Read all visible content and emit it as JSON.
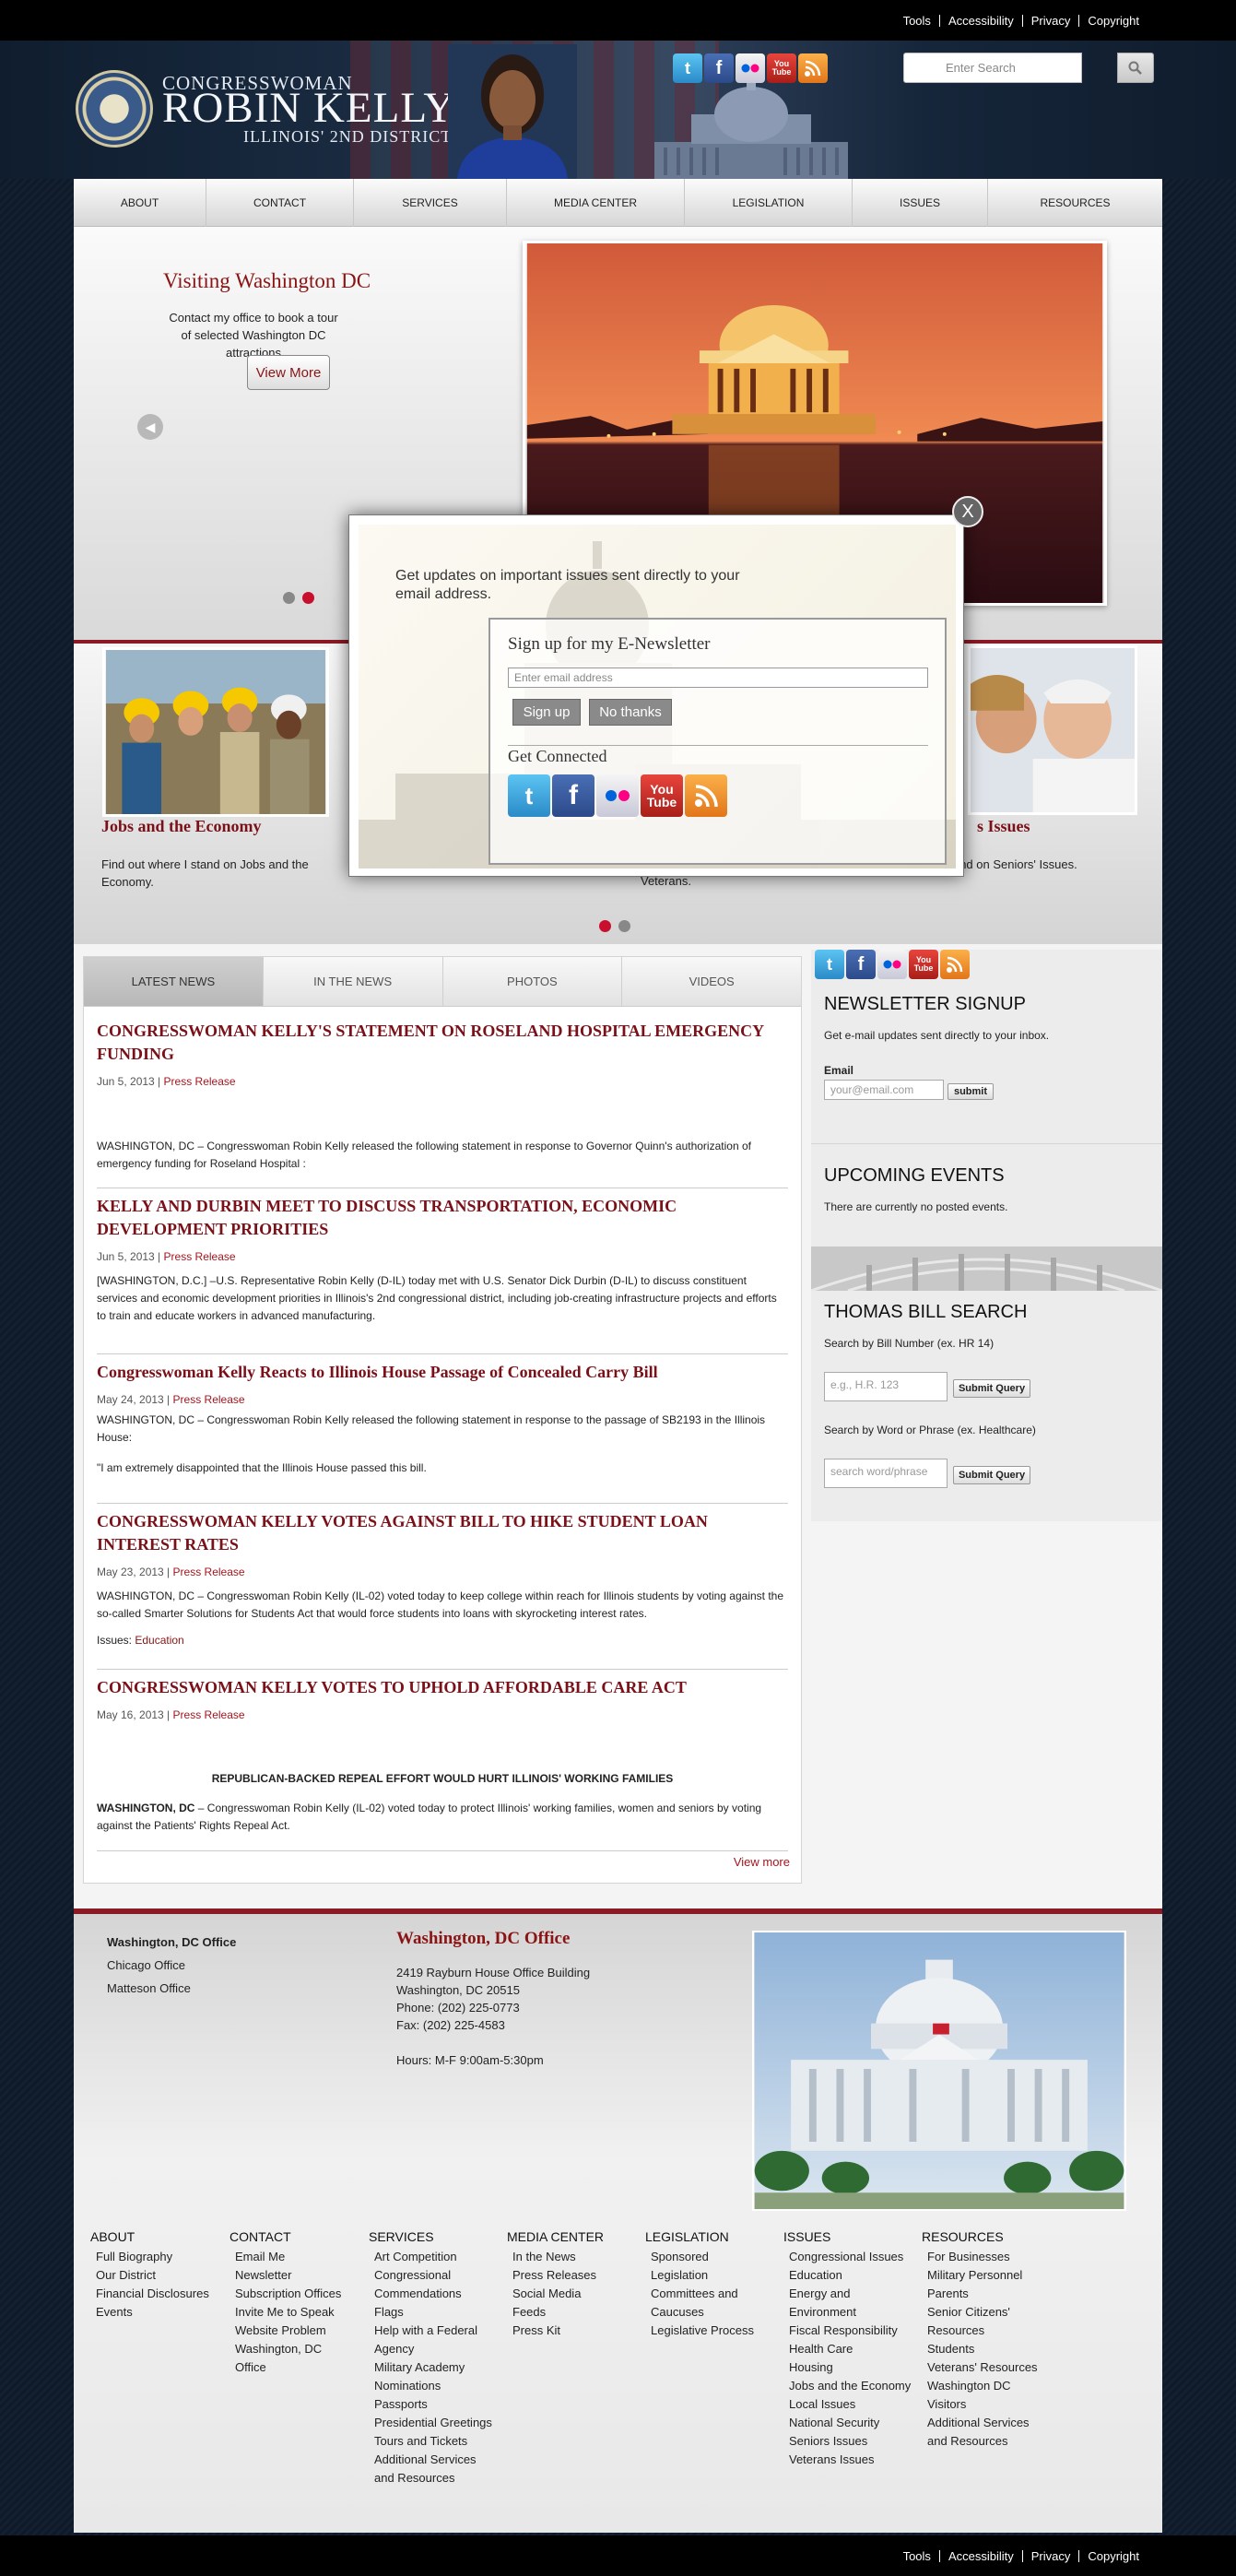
{
  "utility": {
    "tools": "Tools",
    "accessibility": "Accessibility",
    "privacy": "Privacy",
    "copyright": "Copyright"
  },
  "header": {
    "line1": "CONGRESSWOMAN",
    "line2": "ROBIN KELLY",
    "line3": "ILLINOIS' 2ND DISTRICT",
    "search_placeholder": "Enter Search",
    "social": {
      "twitter": "t",
      "facebook": "f",
      "youtube1": "You",
      "youtube2": "Tube"
    }
  },
  "nav": [
    "ABOUT",
    "CONTACT",
    "SERVICES",
    "MEDIA CENTER",
    "LEGISLATION",
    "ISSUES",
    "RESOURCES"
  ],
  "slider": {
    "title": "Visiting Washington DC",
    "text": "Contact my office to book a tour of selected Washington DC attractions",
    "button": "View More"
  },
  "features": [
    {
      "title": "Jobs and the Economy",
      "text": "Find out where I stand on Jobs and the Economy."
    },
    {
      "title": "",
      "text": "Veterans."
    },
    {
      "title": "s Issues",
      "text": "here I stand on Seniors' Issues."
    }
  ],
  "modal": {
    "intro": "Get updates on important issues sent directly to your email address.",
    "title": "Sign up for my E-Newsletter",
    "email_placeholder": "Enter email address",
    "signup": "Sign up",
    "nothanks": "No thanks",
    "connected": "Get Connected",
    "close": "X"
  },
  "tabs": [
    "LATEST NEWS",
    "IN THE NEWS",
    "PHOTOS",
    "VIDEOS"
  ],
  "news": [
    {
      "title": "CONGRESSWOMAN KELLY'S STATEMENT ON ROSELAND HOSPITAL EMERGENCY FUNDING",
      "date": "Jun 5, 2013",
      "type": "Press Release",
      "body": "WASHINGTON, DC –  Congresswoman Robin Kelly released the following statement in response to Governor Quinn's authorization of emergency funding for Roseland Hospital :"
    },
    {
      "title": "KELLY AND DURBIN MEET TO DISCUSS TRANSPORTATION, ECONOMIC DEVELOPMENT PRIORITIES",
      "date": "Jun 5, 2013",
      "type": "Press Release",
      "body": "[WASHINGTON, D.C.] –U.S. Representative Robin Kelly (D-IL) today met with U.S. Senator Dick Durbin (D-IL) to discuss constituent services and economic development priorities in Illinois's 2nd congressional district, including job-creating infrastructure projects and efforts to train and educate workers in advanced manufacturing."
    },
    {
      "title": "Congresswoman Kelly Reacts to Illinois House Passage of Concealed Carry Bill",
      "date": "May 24, 2013",
      "type": "Press Release",
      "body": "WASHINGTON, DC –  Congresswoman Robin Kelly released the following statement in response to the passage of SB2193 in the Illinois House:",
      "quote": "\"I am extremely disappointed that the Illinois House passed this bill."
    },
    {
      "title": "CONGRESSWOMAN KELLY VOTES AGAINST BILL TO HIKE STUDENT LOAN INTEREST RATES",
      "date": "May 23, 2013",
      "type": "Press Release",
      "body": "WASHINGTON, DC –  Congresswoman Robin Kelly (IL-02) voted today to keep college within reach for Illinois students by voting against the so-called Smarter Solutions for Students Act that would force students into loans with skyrocketing interest rates.",
      "issues_label": "Issues:",
      "issues_value": "Education"
    },
    {
      "title": "CONGRESSWOMAN KELLY VOTES TO UPHOLD AFFORDABLE CARE ACT",
      "date": "May 16, 2013",
      "type": "Press Release",
      "headline": "REPUBLICAN-BACKED REPEAL EFFORT WOULD HURT ILLINOIS' WORKING FAMILIES",
      "body_lead": "WASHINGTON, DC",
      "body": " – Congresswoman Robin Kelly (IL-02) voted today to protect Illinois' working families, women and seniors by voting against the Patients' Rights Repeal Act."
    }
  ],
  "view_more": "View more",
  "sidebar": {
    "newsletter_title": "NEWSLETTER SIGNUP",
    "newsletter_text": "Get e-mail updates sent directly to your inbox.",
    "email_label": "Email",
    "email_placeholder": "your@email.com",
    "submit": "submit",
    "events_title": "UPCOMING EVENTS",
    "events_text": "There are currently no posted events.",
    "thomas_title": "THOMAS BILL SEARCH",
    "bill_label": "Search by Bill Number (ex. HR 14)",
    "bill_placeholder": "e.g., H.R. 123",
    "submit_query": "Submit Query",
    "word_label": "Search by Word or Phrase (ex. Healthcare)",
    "word_placeholder": "search word/phrase"
  },
  "offices": {
    "list": [
      "Washington, DC Office",
      "Chicago Office",
      "Matteson Office"
    ],
    "title": "Washington, DC Office",
    "addr1": "2419 Rayburn House Office Building",
    "addr2": "Washington, DC 20515",
    "phone": "Phone: (202) 225-0773",
    "fax": "Fax:   (202) 225-4583",
    "hours": "Hours: M-F 9:00am-5:30pm"
  },
  "footer_cols": [
    {
      "head": "ABOUT",
      "items": [
        "Full Biography",
        "Our District",
        "Financial Disclosures",
        "Events"
      ]
    },
    {
      "head": "CONTACT",
      "items": [
        "Email Me",
        "Newsletter Subscription Offices",
        "Invite Me to Speak",
        "Website Problem",
        "Washington, DC Office"
      ]
    },
    {
      "head": "SERVICES",
      "items": [
        "Art Competition",
        "Congressional Commendations",
        "Flags",
        "Help with a Federal Agency",
        "Military Academy Nominations",
        "Passports",
        "Presidential Greetings",
        "Tours and Tickets",
        "Additional Services and Resources"
      ]
    },
    {
      "head": "MEDIA CENTER",
      "items": [
        "In the News",
        "Press Releases",
        "Social Media",
        "Feeds",
        "Press Kit"
      ]
    },
    {
      "head": "LEGISLATION",
      "items": [
        "Sponsored Legislation",
        "Committees and Caucuses",
        "Legislative Process"
      ]
    },
    {
      "head": "ISSUES",
      "items": [
        "Congressional Issues",
        "Education",
        "Energy and Environment",
        "Fiscal Responsibility",
        "Health Care",
        "Housing",
        "Jobs and the Economy",
        "Local Issues",
        "National Security",
        "Seniors Issues",
        "Veterans Issues"
      ]
    },
    {
      "head": "RESOURCES",
      "items": [
        "For Businesses",
        "Military Personnel",
        "Parents",
        "Senior Citizens' Resources",
        "Students",
        "Veterans' Resources",
        "Washington DC Visitors",
        "Additional Services and Resources"
      ]
    }
  ]
}
